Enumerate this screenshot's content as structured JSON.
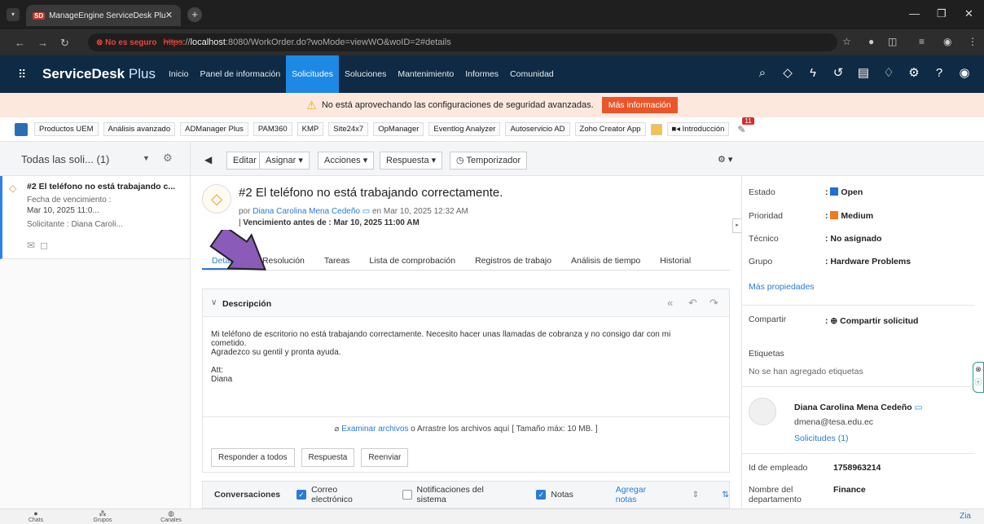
{
  "browser": {
    "tab_title": "ManageEngine ServiceDesk Plu",
    "favicon_text": "SD",
    "security_label": "No es seguro",
    "url_scheme": "https",
    "url_scheme_sep": "://",
    "url_host": "localhost",
    "url_rest": ":8080/WorkOrder.do?woMode=viewWO&woID=2#details"
  },
  "app": {
    "brand": "ServiceDesk",
    "brand_suffix": "Plus",
    "nav": [
      "Inicio",
      "Panel de información",
      "Solicitudes",
      "Soluciones",
      "Mantenimiento",
      "Informes",
      "Comunidad"
    ],
    "active_nav": "Solicitudes"
  },
  "warning": {
    "text": "No está aprovechando las configuraciones de seguridad avanzadas.",
    "button": "Más información"
  },
  "bookmarks": [
    "Productos UEM",
    "Análisis avanzado",
    "ADManager Plus",
    "PAM360",
    "KMP",
    "Site24x7",
    "OpManager",
    "Eventlog Analyzer",
    "Autoservicio AD",
    "Zoho Creator App",
    "Introducción"
  ],
  "bookmark_badge": "11",
  "list": {
    "view_title": "Todas las soli...",
    "count": "(1)",
    "item_title": "#2 El teléfono no está trabajando c...",
    "due_label": "Fecha de vencimiento :",
    "due_value": "Mar 10, 2025 11:0...",
    "requester": "Solicitante : Diana Caroli..."
  },
  "toolbar": {
    "edit": "Editar",
    "assign": "Asignar",
    "actions": "Acciones",
    "reply": "Respuesta",
    "timer": "Temporizador"
  },
  "request": {
    "title": "#2  El teléfono no está trabajando correctamente.",
    "by_label": "por",
    "requester": "Diana Carolina Mena Cedeño",
    "created": "en Mar 10, 2025 12:32 AM",
    "due": "Vencimiento antes de : Mar 10, 2025 11:00 AM"
  },
  "tabs": [
    "Detalles",
    "Resolución",
    "Tareas",
    "Lista de comprobación",
    "Registros de trabajo",
    "Análisis de tiempo",
    "Historial"
  ],
  "description": {
    "header": "Descripción",
    "body": "Mi teléfono de escritorio no está trabajando correctamente. Necesito hacer unas llamadas de cobranza y no consigo dar con mi\ncometido.\nAgradezco su gentil y pronta ayuda.\n\nAtt:\nDiana",
    "attach_link": "Examinar archivos",
    "attach_rest": " o Arrastre los archivos aquí [ Tamaño máx: 10 MB. ]"
  },
  "response_buttons": [
    "Responder a todos",
    "Respuesta",
    "Reenviar"
  ],
  "conversations": {
    "label": "Conversaciones",
    "email": "Correo electrónico",
    "system": "Notificaciones del sistema",
    "notes": "Notas",
    "add_notes": "Agregar notas"
  },
  "properties": {
    "status_label": "Estado",
    "status_value": "Open",
    "status_color": "#1e6fd9",
    "priority_label": "Prioridad",
    "priority_value": "Medium",
    "priority_color": "#f07c1e",
    "tech_label": "Técnico",
    "tech_value": ": No asignado",
    "group_label": "Grupo",
    "group_value": ": Hardware Problems",
    "more": "Más propiedades",
    "share_label": "Compartir",
    "share_value": "Compartir solicitud",
    "tags_label": "Etiquetas",
    "tags_empty": "No se han agregado etiquetas",
    "requester_name": "Diana Carolina Mena Cedeño",
    "requester_email": "dmena@tesa.edu.ec",
    "requester_requests": "Solicitudes (1)",
    "emp_id_label": "Id de empleado",
    "emp_id_value": "1758963214",
    "dept_label": "Nombre del departamento",
    "dept_value": "Finance"
  },
  "bottom": {
    "chats": "Chats",
    "groups": "Grupos",
    "channels": "Canales",
    "zia": "Zia"
  }
}
